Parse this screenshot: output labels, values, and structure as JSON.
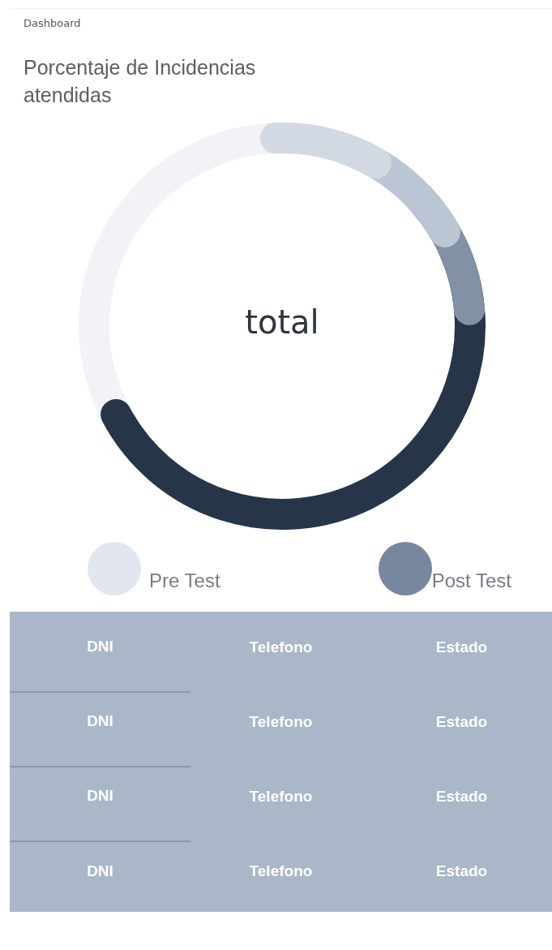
{
  "breadcrumb": "Dashboard",
  "card": {
    "title": "Porcentaje de Incidencias atendidas",
    "center_label": "total",
    "legend": [
      {
        "label": "Pre Test",
        "color": "#e1e6ef"
      },
      {
        "label": "Post Test",
        "color": "#77879f"
      }
    ]
  },
  "table": {
    "rows": [
      [
        "DNI",
        "Telefono",
        "Estado"
      ],
      [
        "DNI",
        "Telefono",
        "Estado"
      ],
      [
        "DNI",
        "Telefono",
        "Estado"
      ],
      [
        "DNI",
        "Telefono",
        "Estado"
      ]
    ]
  }
}
